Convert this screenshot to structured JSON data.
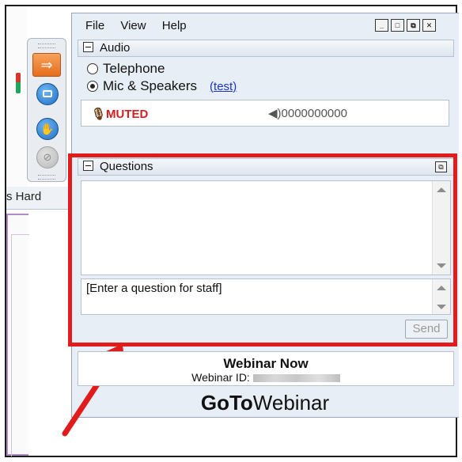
{
  "menu": {
    "file": "File",
    "view": "View",
    "help": "Help"
  },
  "window_buttons": {
    "minimize": "_",
    "restore": "□",
    "maximize": "⧉",
    "close": "✕"
  },
  "left_app": {
    "partial_tab_label": "s Hard"
  },
  "audio": {
    "header": "Audio",
    "option_telephone": "Telephone",
    "option_mic": "Mic & Speakers",
    "test_link": "(test)",
    "selected": "Mic & Speakers",
    "status": "MUTED",
    "volume_meter": "◀)0000000000"
  },
  "questions": {
    "header": "Questions",
    "input_placeholder": "[Enter a question for staff]",
    "send_label": "Send"
  },
  "webinar": {
    "title": "Webinar Now",
    "id_label": "Webinar ID:"
  },
  "brand": {
    "bold": "GoTo",
    "light": "Webinar"
  },
  "colors": {
    "highlight": "#e11c1c",
    "muted": "#d31f1f",
    "link": "#1a33cc",
    "panel_bg": "#e8eef6"
  }
}
